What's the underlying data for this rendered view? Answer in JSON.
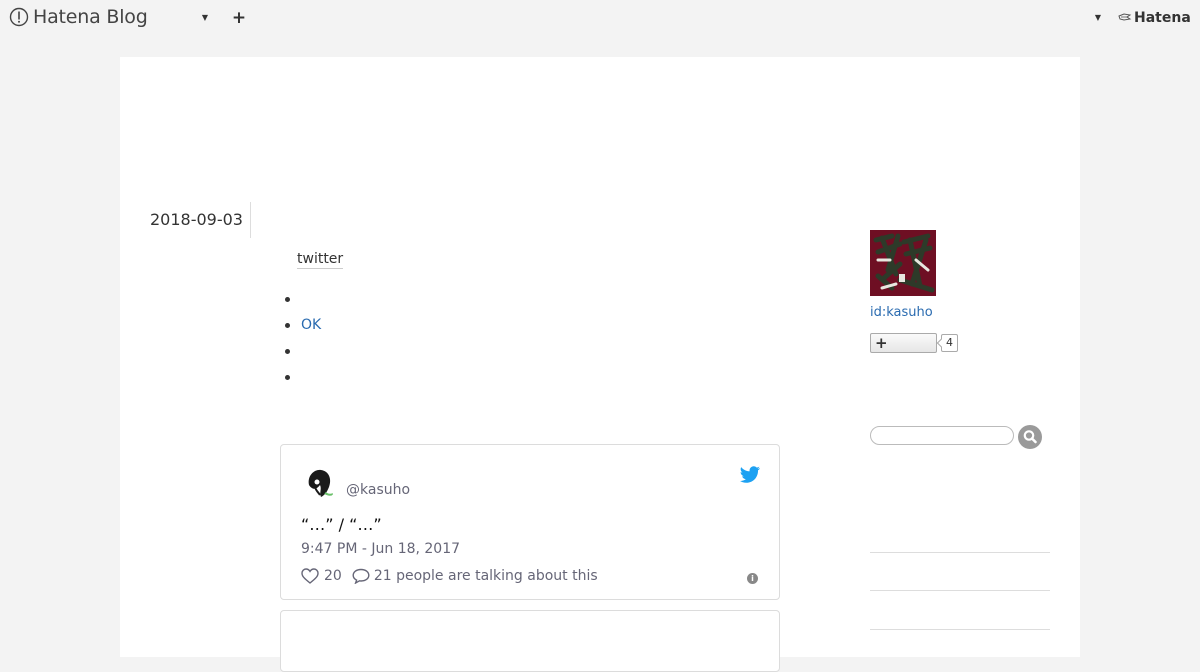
{
  "header": {
    "brand": "Hatena Blog",
    "add_symbol": "+",
    "hatena_logo": "Hatena",
    "icons": [
      "hatena-blog-logo-icon",
      "caret-down-icon",
      "plus-icon",
      "caret-down-icon",
      "hatena-bird-icon"
    ]
  },
  "entry": {
    "date": "2018-09-03",
    "category": "twitter",
    "list_items": [
      "",
      "OK",
      "",
      ""
    ]
  },
  "tweet": {
    "handle": "@kasuho",
    "text": "“…” / “…”",
    "time": "9:47 PM - Jun 18, 2017",
    "likes": "20",
    "talking": "21 people are talking about this",
    "info_symbol": "i"
  },
  "sidebar": {
    "profile_id": "id:kasuho",
    "follow_symbol": "+",
    "follower_count": "4",
    "search_placeholder": ""
  },
  "colors": {
    "link": "#2a6bb0",
    "twitter_blue": "#1da1f2",
    "avatar_bg": "#6e0f23",
    "page_bg": "#f3f3f3"
  }
}
